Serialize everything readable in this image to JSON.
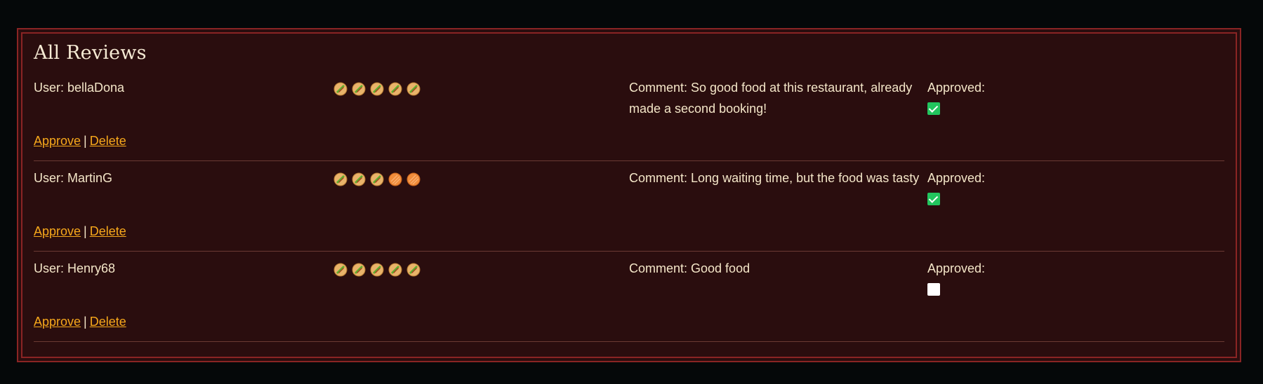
{
  "page": {
    "title": "All Reviews"
  },
  "colors": {
    "panel_bg": "#2a0d0e",
    "border": "#8a2424",
    "link": "#f7a81b",
    "approved_check": "#22c55e"
  },
  "rating_max": 5,
  "reviews": [
    {
      "user": "User: bellaDona",
      "rating": 5,
      "comment": "Comment: So good food at this restaurant, already made a second booking!",
      "approved_label": "Approved:",
      "approved": true,
      "approve_label": "Approve",
      "separator": "|",
      "delete_label": "Delete"
    },
    {
      "user": "User: MartinG",
      "rating": 3,
      "comment": "Comment: Long waiting time, but the food was tasty",
      "approved_label": "Approved:",
      "approved": true,
      "approve_label": "Approve",
      "separator": "|",
      "delete_label": "Delete"
    },
    {
      "user": "User: Henry68",
      "rating": 5,
      "comment": "Comment: Good food",
      "approved_label": "Approved:",
      "approved": false,
      "approve_label": "Approve",
      "separator": "|",
      "delete_label": "Delete"
    }
  ]
}
